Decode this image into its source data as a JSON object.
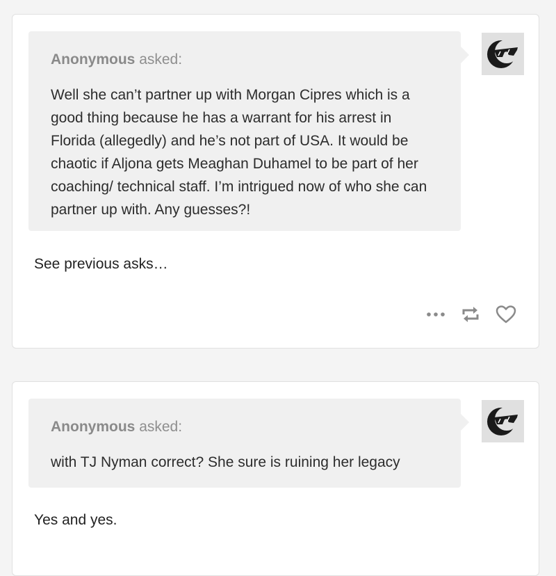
{
  "posts": [
    {
      "asker_name": "Anonymous",
      "asked_label": "asked:",
      "question": "Well she can’t partner up with Morgan Cipres which is a good thing because he has a warrant for his arrest in Florida (allegedly) and he’s not part of USA. It would be chaotic if Aljona gets Meaghan Duhamel to be part of her coaching/ technical staff. I’m intrigued now of who she can partner up with. Any guesses?!",
      "answer": "See previous asks…",
      "avatar_icon": "sunglasses-moon-icon",
      "actions": [
        "more-icon",
        "reblog-icon",
        "heart-icon"
      ]
    },
    {
      "asker_name": "Anonymous",
      "asked_label": "asked:",
      "question": "with TJ Nyman correct? She sure is ruining her legacy",
      "answer": "Yes and yes.",
      "avatar_icon": "sunglasses-moon-icon"
    }
  ],
  "colors": {
    "background": "#f4f4f4",
    "card": "#ffffff",
    "ask_bubble": "#f0f0f0",
    "muted_text": "#8e8e8e",
    "icon": "#8a8a8a"
  }
}
